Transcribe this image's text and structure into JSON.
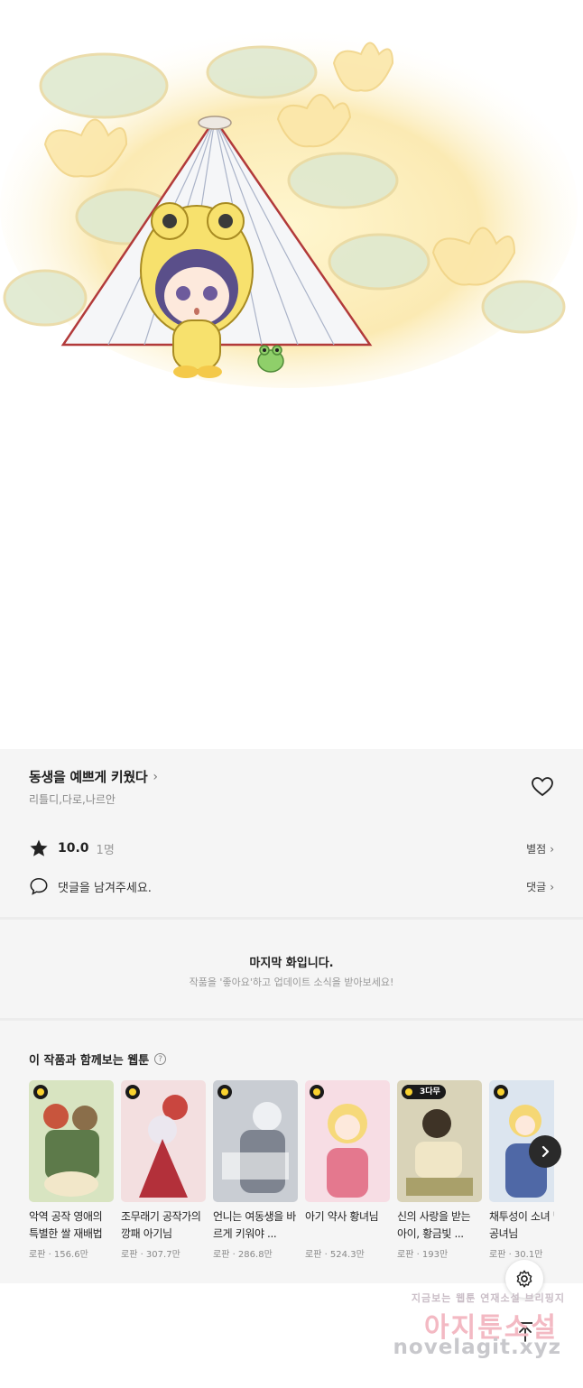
{
  "episode": {
    "title": "동생을 예쁘게 키웠다",
    "authors": "리틀디,다로,나르안"
  },
  "rating": {
    "score": "10.0",
    "count": "1명",
    "link_label": "별점"
  },
  "comments": {
    "prompt": "댓글을 남겨주세요.",
    "link_label": "댓글"
  },
  "last_episode": {
    "title": "마지막 화입니다.",
    "subtitle": "작품을 '좋아요'하고 업데이트 소식을 받아보세요!"
  },
  "recommendations": {
    "title": "이 작품과 함께보는 웹툰",
    "help_glyph": "?",
    "items": [
      {
        "name": "악역 공작 영애의 특별한 쌀 재배법",
        "meta": "로판 · 156.6만",
        "badge": "",
        "color": "#b9c99a"
      },
      {
        "name": "조무래기 공작가의 깡패 아기님",
        "meta": "로판 · 307.7만",
        "badge": "",
        "color": "#c9463f"
      },
      {
        "name": "언니는 여동생을 바르게 키워야 ...",
        "meta": "로판 · 286.8만",
        "badge": "",
        "color": "#9aa0a8"
      },
      {
        "name": "아기 약사 황녀님",
        "meta": "로판 · 524.3만",
        "badge": "",
        "color": "#f2c7cf"
      },
      {
        "name": "신의 사랑을 받는 아이, 황금빛 ...",
        "meta": "로판 · 193만",
        "badge": "3다무",
        "color": "#b7b08b"
      },
      {
        "name": "채투성이 소녀 빛의 공녀님",
        "meta": "로판 · 30.1만",
        "badge": "",
        "color": "#6d86b8"
      }
    ]
  },
  "watermark": {
    "line1": "지금보는 웹툰 연재소설 브리핑지",
    "line2": "아지툰소설",
    "line3": "novelagit.xyz"
  },
  "icons": {
    "heart": "heart-outline-icon",
    "star": "star-icon",
    "comment": "speech-bubble-icon",
    "next": "chevron-right-icon",
    "settings": "gear-icon",
    "top": "arrow-up-icon"
  }
}
